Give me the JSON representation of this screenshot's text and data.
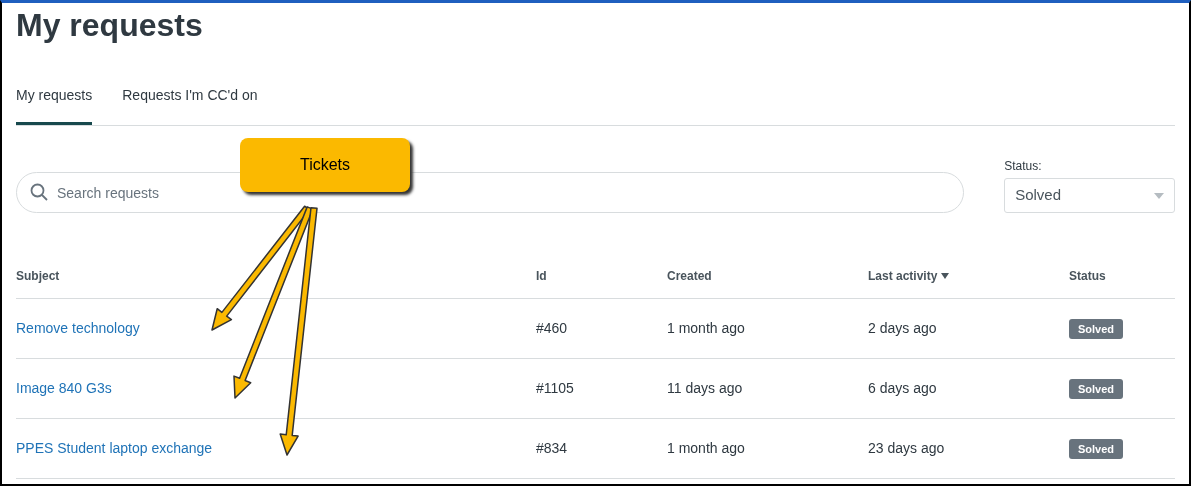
{
  "title": "My requests",
  "tabs": [
    {
      "label": "My requests",
      "selected": true
    },
    {
      "label": "Requests I'm CC'd on",
      "selected": false
    }
  ],
  "search": {
    "placeholder": "Search requests"
  },
  "status_filter": {
    "label": "Status:",
    "value": "Solved"
  },
  "table": {
    "columns": [
      {
        "label": "Subject",
        "sorted": false
      },
      {
        "label": "Id",
        "sorted": false
      },
      {
        "label": "Created",
        "sorted": false
      },
      {
        "label": "Last activity",
        "sorted": true
      },
      {
        "label": "Status",
        "sorted": false
      }
    ],
    "rows": [
      {
        "subject": "Remove technology",
        "id": "#460",
        "created": "1 month ago",
        "last_activity": "2 days ago",
        "status": "Solved"
      },
      {
        "subject": "Image 840 G3s",
        "id": "#1105",
        "created": "11 days ago",
        "last_activity": "6 days ago",
        "status": "Solved"
      },
      {
        "subject": "PPES Student laptop exchange",
        "id": "#834",
        "created": "1 month ago",
        "last_activity": "23 days ago",
        "status": "Solved"
      }
    ]
  },
  "callout": {
    "text": "Tickets"
  }
}
